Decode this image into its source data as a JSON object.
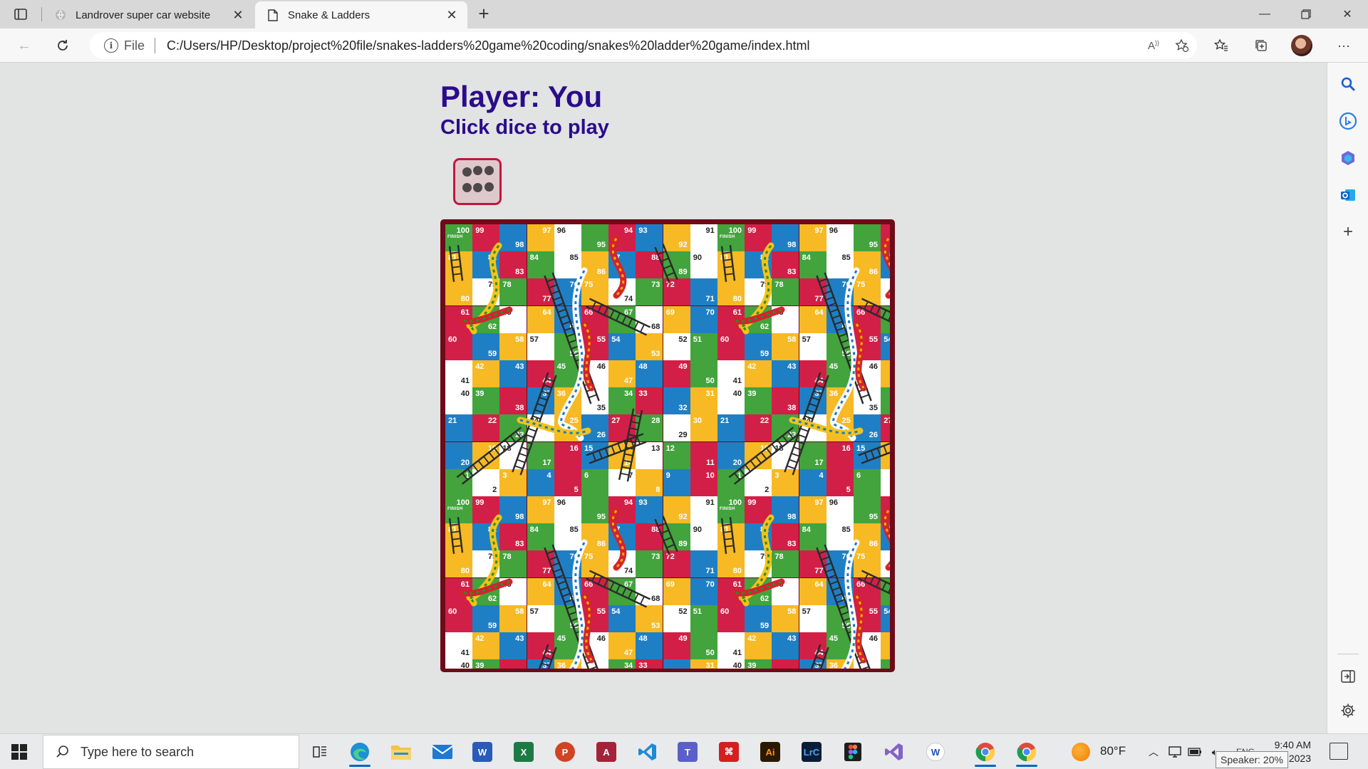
{
  "browser": {
    "tabs": [
      {
        "title": "Landrover super car website",
        "favicon": "globe-icon",
        "active": false
      },
      {
        "title": "Snake & Ladders",
        "favicon": "page-icon",
        "active": true
      }
    ],
    "address": {
      "scheme_label": "File",
      "url": "C:/Users/HP/Desktop/project%20file/snakes-ladders%20game%20coding/snakes%20ladder%20game/index.html"
    }
  },
  "game": {
    "player_label": "Player: You",
    "instruction": "Click dice to play",
    "dice_value": 6,
    "board": {
      "finish_label": "FINISH",
      "snakes": 6,
      "ladders": 8
    },
    "colors": {
      "red": "#d21f47",
      "yellow": "#f7b924",
      "green": "#43a33d",
      "blue": "#1f7fc5",
      "white": "#ffffff",
      "border": "#6d0b19",
      "title": "#2b0c8a"
    }
  },
  "taskbar": {
    "search_placeholder": "Type here to search",
    "weather_temp": "80°F",
    "time": "9:40 AM",
    "date_partial": "2023",
    "lang_partial": "ENG",
    "tooltip": "Speaker: 20%",
    "apps": [
      "task-view",
      "edge",
      "file-explorer",
      "mail",
      "word",
      "excel",
      "powerpoint",
      "access",
      "vscode",
      "teams",
      "acrobat",
      "illustrator",
      "lightroom",
      "figma",
      "visual-studio",
      "w-app",
      "chrome",
      "chrome-2"
    ]
  }
}
